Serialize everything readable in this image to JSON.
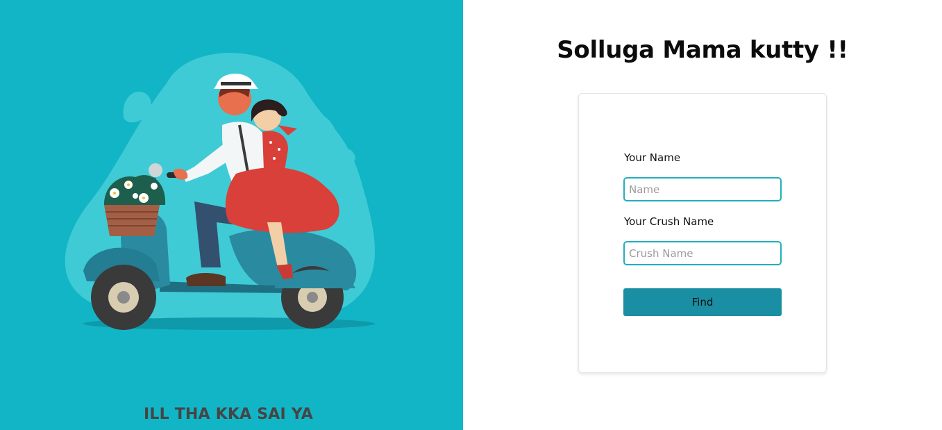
{
  "title": "Solluga Mama kutty !!",
  "tagline": "ILL THA KKA SAI YA",
  "form": {
    "name_label": "Your Name",
    "name_placeholder": "Name",
    "name_value": "",
    "crush_label": "Your Crush Name",
    "crush_placeholder": "Crush Name",
    "crush_value": "",
    "button_label": "Find"
  },
  "colors": {
    "left_panel_bg": "#12b5c6",
    "input_border": "#21aebd",
    "button_bg": "#1a8fa3"
  },
  "illustration": {
    "subject": "couple-on-scooter-illustration"
  }
}
